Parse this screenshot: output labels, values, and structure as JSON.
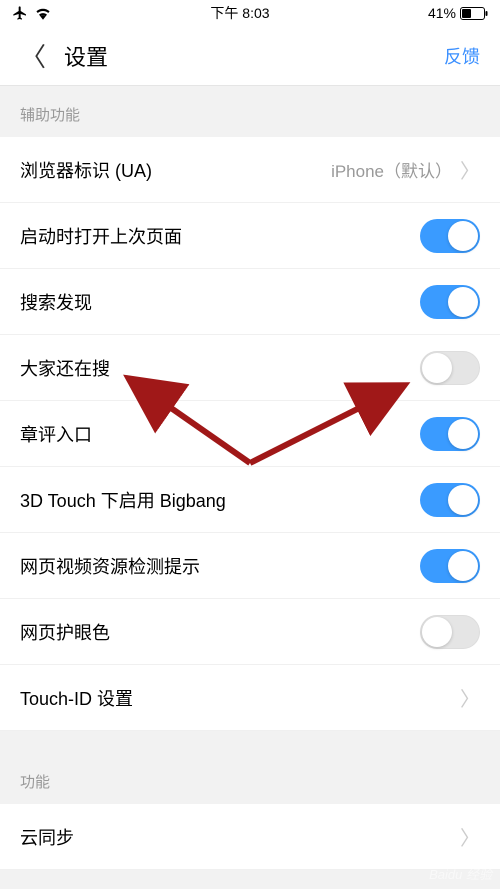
{
  "status_bar": {
    "time": "下午 8:03",
    "battery_pct": "41%"
  },
  "nav": {
    "title": "设置",
    "feedback": "反馈"
  },
  "section1_header": "辅助功能",
  "section2_header": "功能",
  "items": {
    "ua": {
      "label": "浏览器标识 (UA)",
      "value": "iPhone（默认）"
    },
    "restore_tabs": {
      "label": "启动时打开上次页面"
    },
    "search_discover": {
      "label": "搜索发现"
    },
    "others_search": {
      "label": "大家还在搜"
    },
    "review_entry": {
      "label": "章评入口"
    },
    "bigbang": {
      "label": "3D Touch 下启用 Bigbang"
    },
    "video_detect": {
      "label": "网页视频资源检测提示"
    },
    "eye_protect": {
      "label": "网页护眼色"
    },
    "touchid": {
      "label": "Touch-ID 设置"
    },
    "cloud_sync": {
      "label": "云同步"
    }
  },
  "toggles": {
    "restore_tabs": true,
    "search_discover": true,
    "others_search": false,
    "review_entry": true,
    "bigbang": true,
    "video_detect": true,
    "eye_protect": false
  },
  "watermark": "Baidu 经验"
}
